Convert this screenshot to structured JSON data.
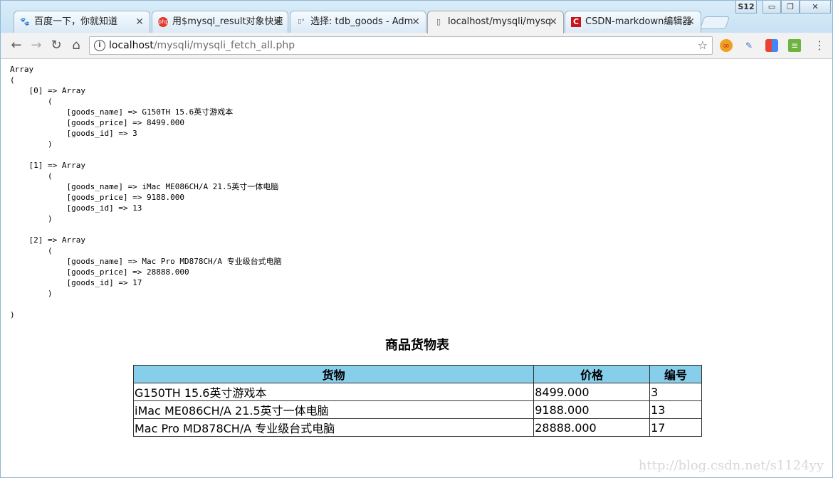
{
  "browser": {
    "tabs": [
      {
        "title": "百度一下，你就知道",
        "icon": "baidu-paw-icon",
        "active": false
      },
      {
        "title": "用$mysql_result对象快速",
        "icon": "php-logo-icon",
        "active": false
      },
      {
        "title": "选择: tdb_goods - Adm",
        "icon": "phpmyadmin-icon",
        "active": false
      },
      {
        "title": "localhost/mysqli/mysq",
        "icon": "page-icon",
        "active": true
      },
      {
        "title": "CSDN-markdown编辑器",
        "icon": "csdn-logo-icon",
        "active": false
      }
    ],
    "profile_badge": "S12",
    "url_host": "localhost",
    "url_path": "/mysqli/mysqli_fetch_all.php",
    "accent": "#87ceeb"
  },
  "page": {
    "dump": "Array\n(\n    [0] => Array\n        (\n            [goods_name] => G150TH 15.6英寸游戏本\n            [goods_price] => 8499.000\n            [goods_id] => 3\n        )\n\n    [1] => Array\n        (\n            [goods_name] => iMac ME086CH/A 21.5英寸一体电脑\n            [goods_price] => 9188.000\n            [goods_id] => 13\n        )\n\n    [2] => Array\n        (\n            [goods_name] => Mac Pro MD878CH/A 专业级台式电脑\n            [goods_price] => 28888.000\n            [goods_id] => 17\n        )\n\n)",
    "table_title": "商品货物表",
    "table": {
      "headers": [
        "货物",
        "价格",
        "编号"
      ],
      "rows": [
        [
          "G150TH 15.6英寸游戏本",
          "8499.000",
          "3"
        ],
        [
          "iMac ME086CH/A 21.5英寸一体电脑",
          "9188.000",
          "13"
        ],
        [
          "Mac Pro MD878CH/A 专业级台式电脑",
          "28888.000",
          "17"
        ]
      ]
    },
    "watermark": "http://blog.csdn.net/s1124yy"
  }
}
